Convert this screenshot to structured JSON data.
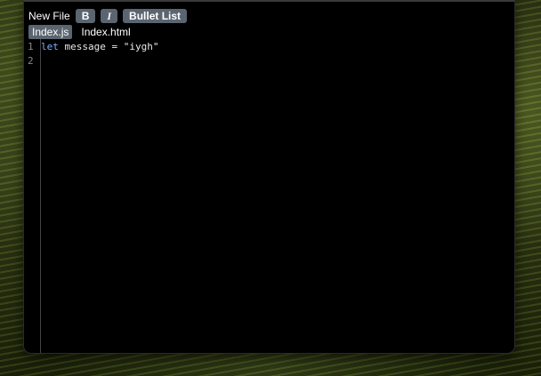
{
  "toolbar": {
    "new_file_label": "New File",
    "bold_label": "B",
    "italic_label": "I",
    "bullet_list_label": "Bullet List"
  },
  "tabs": [
    {
      "label": "Index.js",
      "active": true
    },
    {
      "label": "Index.html",
      "active": false
    }
  ],
  "editor": {
    "line_numbers": [
      "1",
      "2"
    ],
    "lines": [
      {
        "keyword": "let",
        "rest": " message = \"iygh\""
      },
      {
        "keyword": "",
        "rest": ""
      }
    ]
  },
  "colors": {
    "button_bg": "#5b6570",
    "editor_bg": "#000000",
    "keyword": "#7fb0ff"
  }
}
